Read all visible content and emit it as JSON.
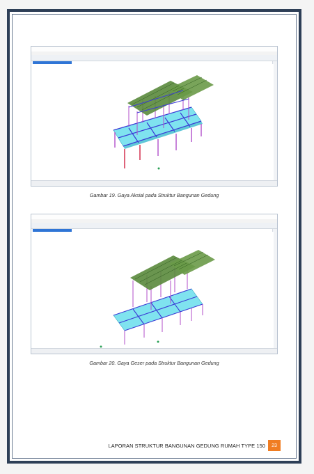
{
  "figure_1": {
    "caption": "Gambar 19. Gaya Aksial pada Struktur Bangunan Gedung"
  },
  "figure_2": {
    "caption": "Gambar 20. Gaya Geser pada Struktur Bangunan Gedung"
  },
  "footer": {
    "title": "LAPORAN STRUKTUR BANGUNAN GEDUNG RUMAH TYPE 150",
    "page_number": "23"
  },
  "colors": {
    "frame": "#2e3f57",
    "slab": "#7fe3ef",
    "roof": "#5a8a3c",
    "beam": "#3b3bd6",
    "column": "#b04ec9",
    "axial_column": "#d02040",
    "page_badge": "#f07d22"
  },
  "icons": [
    "structure-3d-model",
    "window-controls"
  ]
}
